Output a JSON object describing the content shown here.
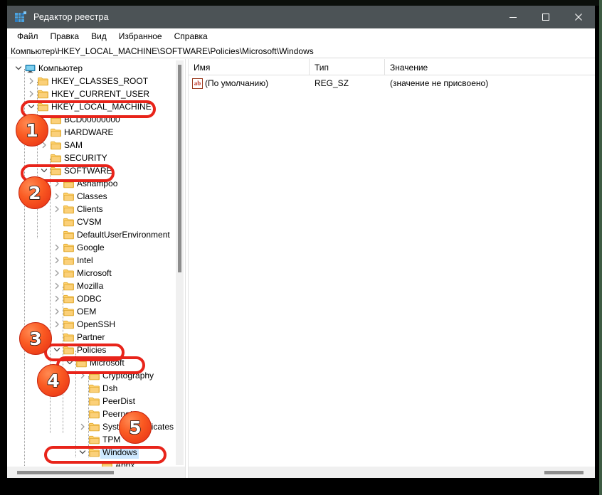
{
  "window": {
    "title": "Редактор реестра",
    "icon": "registry-editor-icon",
    "controls": {
      "minimize": "—",
      "maximize": "□",
      "close": "✕"
    }
  },
  "menu": {
    "items": [
      {
        "label": "Файл"
      },
      {
        "label": "Правка"
      },
      {
        "label": "Вид"
      },
      {
        "label": "Избранное"
      },
      {
        "label": "Справка"
      }
    ]
  },
  "address": {
    "path": "Компьютер\\HKEY_LOCAL_MACHINE\\SOFTWARE\\Policies\\Microsoft\\Windows"
  },
  "tree": {
    "nodes": [
      {
        "label": "Компьютер",
        "depth": 0,
        "twist": "down",
        "icon": "monitor-icon",
        "selected": false
      },
      {
        "label": "HKEY_CLASSES_ROOT",
        "depth": 1,
        "twist": "right",
        "icon": "folder-icon",
        "selected": false
      },
      {
        "label": "HKEY_CURRENT_USER",
        "depth": 1,
        "twist": "right",
        "icon": "folder-icon",
        "selected": false
      },
      {
        "label": "HKEY_LOCAL_MACHINE",
        "depth": 1,
        "twist": "down",
        "icon": "folder-icon",
        "selected": false
      },
      {
        "label": "BCD00000000",
        "depth": 2,
        "twist": "none",
        "icon": "folder-icon",
        "selected": false
      },
      {
        "label": "HARDWARE",
        "depth": 2,
        "twist": "none",
        "icon": "folder-icon",
        "selected": false
      },
      {
        "label": "SAM",
        "depth": 2,
        "twist": "right",
        "icon": "folder-icon",
        "selected": false
      },
      {
        "label": "SECURITY",
        "depth": 2,
        "twist": "none",
        "icon": "folder-icon",
        "selected": false
      },
      {
        "label": "SOFTWARE",
        "depth": 2,
        "twist": "down",
        "icon": "folder-icon",
        "selected": false
      },
      {
        "label": "Ashampoo",
        "depth": 3,
        "twist": "right",
        "icon": "folder-icon",
        "selected": false
      },
      {
        "label": "Classes",
        "depth": 3,
        "twist": "right",
        "icon": "folder-icon",
        "selected": false
      },
      {
        "label": "Clients",
        "depth": 3,
        "twist": "right",
        "icon": "folder-icon",
        "selected": false
      },
      {
        "label": "CVSM",
        "depth": 3,
        "twist": "none",
        "icon": "folder-icon",
        "selected": false
      },
      {
        "label": "DefaultUserEnvironment",
        "depth": 3,
        "twist": "none",
        "icon": "folder-icon",
        "selected": false
      },
      {
        "label": "Google",
        "depth": 3,
        "twist": "right",
        "icon": "folder-icon",
        "selected": false
      },
      {
        "label": "Intel",
        "depth": 3,
        "twist": "right",
        "icon": "folder-icon",
        "selected": false
      },
      {
        "label": "Microsoft",
        "depth": 3,
        "twist": "right",
        "icon": "folder-icon",
        "selected": false
      },
      {
        "label": "Mozilla",
        "depth": 3,
        "twist": "right",
        "icon": "folder-icon",
        "selected": false
      },
      {
        "label": "ODBC",
        "depth": 3,
        "twist": "right",
        "icon": "folder-icon",
        "selected": false
      },
      {
        "label": "OEM",
        "depth": 3,
        "twist": "right",
        "icon": "folder-icon",
        "selected": false
      },
      {
        "label": "OpenSSH",
        "depth": 3,
        "twist": "right",
        "icon": "folder-icon",
        "selected": false
      },
      {
        "label": "Partner",
        "depth": 3,
        "twist": "none",
        "icon": "folder-icon",
        "selected": false
      },
      {
        "label": "Policies",
        "depth": 3,
        "twist": "down",
        "icon": "folder-icon",
        "selected": false
      },
      {
        "label": "Microsoft",
        "depth": 4,
        "twist": "down",
        "icon": "folder-icon",
        "selected": false
      },
      {
        "label": "Cryptography",
        "depth": 5,
        "twist": "right",
        "icon": "folder-icon",
        "selected": false
      },
      {
        "label": "Dsh",
        "depth": 5,
        "twist": "none",
        "icon": "folder-icon",
        "selected": false
      },
      {
        "label": "PeerDist",
        "depth": 5,
        "twist": "none",
        "icon": "folder-icon",
        "selected": false
      },
      {
        "label": "Peernet",
        "depth": 5,
        "twist": "none",
        "icon": "folder-icon",
        "selected": false
      },
      {
        "label": "SystemCertificates",
        "depth": 5,
        "twist": "right",
        "icon": "folder-icon",
        "selected": false
      },
      {
        "label": "TPM",
        "depth": 5,
        "twist": "none",
        "icon": "folder-icon",
        "selected": false
      },
      {
        "label": "Windows",
        "depth": 5,
        "twist": "down",
        "icon": "folder-icon",
        "selected": true
      },
      {
        "label": "Appx",
        "depth": 6,
        "twist": "none",
        "icon": "folder-icon",
        "selected": false
      }
    ]
  },
  "values": {
    "columns": [
      "Имя",
      "Тип",
      "Значение"
    ],
    "rows": [
      {
        "name": "(По умолчанию)",
        "type": "REG_SZ",
        "value": "(значение не присвоено)",
        "icon": "ab-string-icon"
      }
    ]
  },
  "annotations": {
    "badges": [
      {
        "number": "1"
      },
      {
        "number": "2"
      },
      {
        "number": "3"
      },
      {
        "number": "4"
      },
      {
        "number": "5"
      }
    ],
    "highlight_color": "#e8241a"
  }
}
